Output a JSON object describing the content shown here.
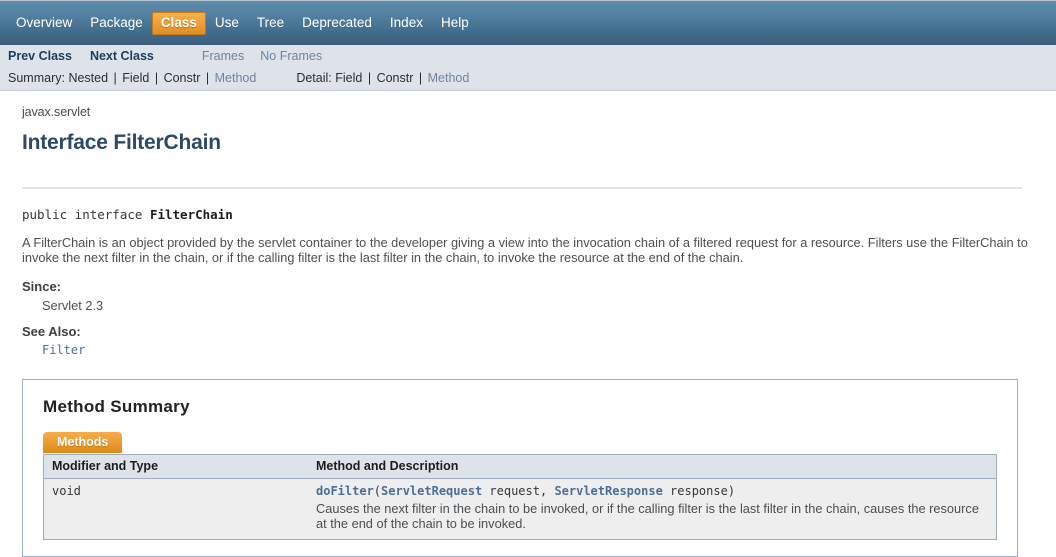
{
  "topnav": {
    "items": [
      {
        "label": "Overview",
        "active": false
      },
      {
        "label": "Package",
        "active": false
      },
      {
        "label": "Class",
        "active": true
      },
      {
        "label": "Use",
        "active": false
      },
      {
        "label": "Tree",
        "active": false
      },
      {
        "label": "Deprecated",
        "active": false
      },
      {
        "label": "Index",
        "active": false
      },
      {
        "label": "Help",
        "active": false
      }
    ],
    "active_tab_color": "#ef9e33"
  },
  "subnav": {
    "prev_class": "Prev Class",
    "next_class": "Next Class",
    "frames": "Frames",
    "no_frames": "No Frames",
    "summary_label": "Summary:",
    "summary_items": [
      "Nested",
      "Field",
      "Constr",
      "Method"
    ],
    "summary_active_link": "Method",
    "detail_label": "Detail:",
    "detail_items": [
      "Field",
      "Constr",
      "Method"
    ],
    "detail_active_link": "Method",
    "separator": "|"
  },
  "header": {
    "package": "javax.servlet",
    "title": "Interface FilterChain"
  },
  "declaration": {
    "modifiers": "public interface ",
    "name": "FilterChain"
  },
  "description": "A FilterChain is an object provided by the servlet container to the developer giving a view into the invocation chain of a filtered request for a resource. Filters use the FilterChain to invoke the next filter in the chain, or if the calling filter is the last filter in the chain, to invoke the resource at the end of the chain.",
  "meta": {
    "since_label": "Since:",
    "since_value": "Servlet 2.3",
    "see_also_label": "See Also:",
    "see_also_value": "Filter"
  },
  "method_summary": {
    "title": "Method Summary",
    "tab_label": "Methods",
    "columns": [
      "Modifier and Type",
      "Method and Description"
    ],
    "rows": [
      {
        "modifier": "void",
        "method_name": "doFilter",
        "open_paren": "(",
        "param1_type": "ServletRequest",
        "param1_name": " request, ",
        "param2_type": "ServletResponse",
        "param2_name": " response)",
        "description": "Causes the next filter in the chain to be invoked, or if the calling filter is the last filter in the chain, causes the resource at the end of the chain to be invoked."
      }
    ]
  }
}
